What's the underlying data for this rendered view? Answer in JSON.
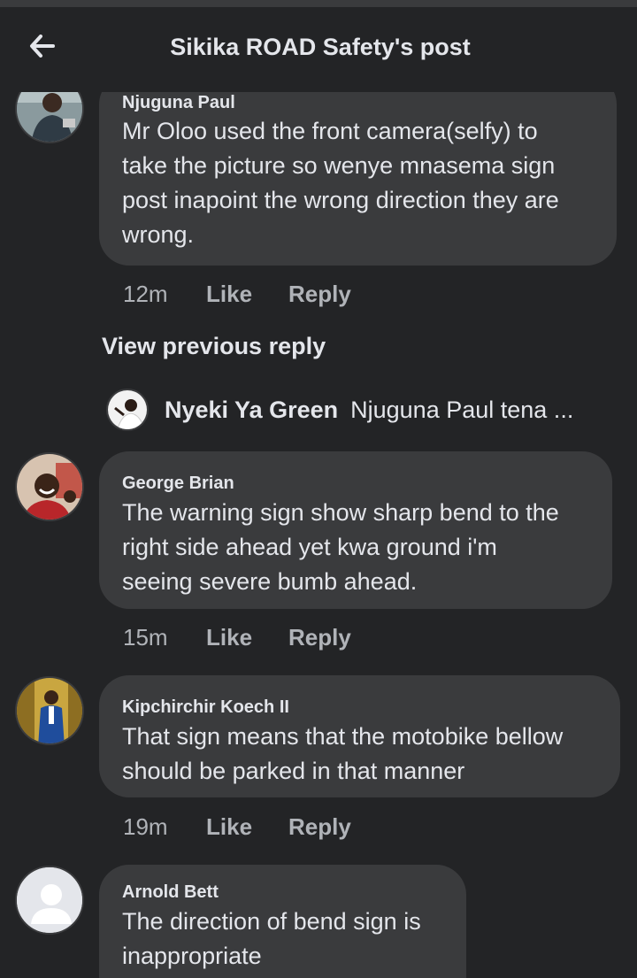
{
  "header": {
    "title": "Sikika ROAD Safety's post",
    "back_icon": "arrow-left-icon"
  },
  "comments": [
    {
      "author": "Njuguna Paul",
      "text": "Mr Oloo used the front camera(selfy) to\ntake the picture so wenye mnasema sign\npost inapoint the wrong direction they are\nwrong.",
      "time": "12m",
      "like": "Like",
      "reply": "Reply"
    },
    {
      "author": "George Brian",
      "text": "The warning sign show sharp bend to the\nright side ahead yet kwa ground i'm\nseeing severe bumb ahead.",
      "time": "15m",
      "like": "Like",
      "reply": "Reply"
    },
    {
      "author": "Kipchirchir Koech II",
      "text": "That sign means that the motobike bellow\nshould be parked in that manner",
      "time": "19m",
      "like": "Like",
      "reply": "Reply"
    },
    {
      "author": "Arnold Bett",
      "text": "The direction of bend sign is\ninappropriate"
    }
  ],
  "view_previous": "View previous reply",
  "reply_preview": {
    "author": "Nyeki Ya Green",
    "text": "Njuguna Paul tena ..."
  },
  "colors": {
    "background": "#232426",
    "bubble": "#3a3b3d",
    "text": "#e4e6eb",
    "muted": "#b0b3b8"
  }
}
